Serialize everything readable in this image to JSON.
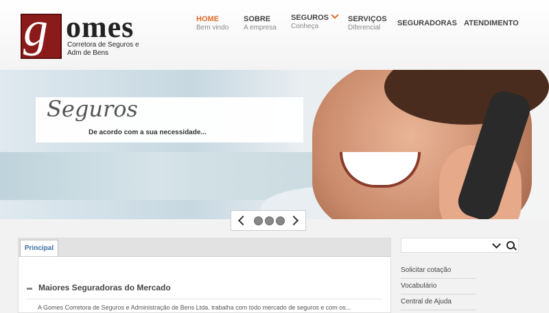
{
  "brand": {
    "logo_letter": "g",
    "logo_word": "omes",
    "tagline": "Corretora de Seguros e Adm de Bens"
  },
  "nav": [
    {
      "label": "HOME",
      "sub": "Bem vindo",
      "active": true
    },
    {
      "label": "SOBRE",
      "sub": "A empresa"
    },
    {
      "label": "SEGUROS",
      "sub": "Conheça",
      "has_dropdown": true
    },
    {
      "label": "SERVIÇOS",
      "sub": "Diferencial"
    },
    {
      "label": "SEGURADORAS",
      "sub": ""
    },
    {
      "label": "ATENDIMENTO",
      "sub": ""
    }
  ],
  "banner": {
    "title": "Seguros",
    "subtitle": "De acordo com a sua necessidade..."
  },
  "slider": {
    "slides": 3
  },
  "main": {
    "tab": "Principal",
    "section_title": "Maiores Seguradoras do Mercado",
    "body_text": "A Gomes Corretora de Seguros e Administração de Bens Ltda. trabalha com todo mercado de seguros e com os..."
  },
  "sidebar": {
    "search_placeholder": "",
    "links": [
      "Solicitar cotação",
      "Vocabulário",
      "Central de Ajuda"
    ]
  },
  "colors": {
    "accent": "#e06a2c",
    "logo_red": "#8b1a1a",
    "tab_text": "#3a6ea5"
  }
}
